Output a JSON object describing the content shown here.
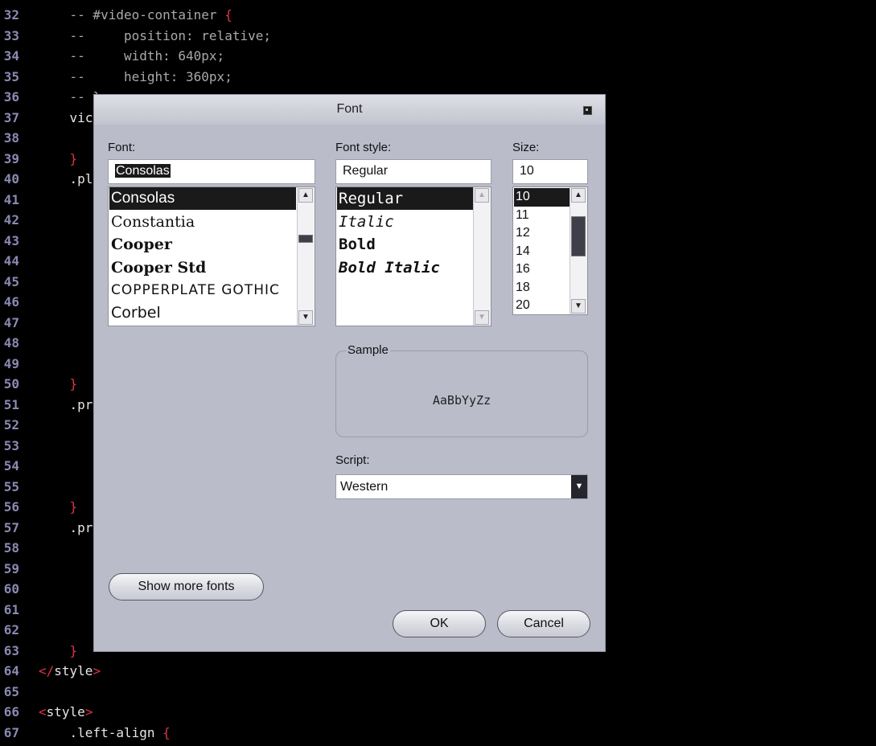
{
  "editor": {
    "lines": [
      {
        "n": "32",
        "tokens": [
          {
            "t": "    -- #video-container ",
            "c": "comment"
          },
          {
            "t": "{",
            "c": "brace"
          }
        ]
      },
      {
        "n": "33",
        "tokens": [
          {
            "t": "    --     position: relative;",
            "c": "comment"
          }
        ]
      },
      {
        "n": "34",
        "tokens": [
          {
            "t": "    --     width: 640px;",
            "c": "comment"
          }
        ]
      },
      {
        "n": "35",
        "tokens": [
          {
            "t": "    --     height: 360px;",
            "c": "comment"
          }
        ]
      },
      {
        "n": "36",
        "tokens": [
          {
            "t": "    -- }",
            "c": "comment"
          }
        ]
      },
      {
        "n": "37",
        "tokens": [
          {
            "t": "    vic",
            "c": "sel"
          }
        ]
      },
      {
        "n": "38",
        "tokens": []
      },
      {
        "n": "39",
        "tokens": [
          {
            "t": "    }",
            "c": "brace"
          }
        ]
      },
      {
        "n": "40",
        "tokens": [
          {
            "t": "    .pl",
            "c": "sel"
          }
        ]
      },
      {
        "n": "41",
        "tokens": []
      },
      {
        "n": "42",
        "tokens": []
      },
      {
        "n": "43",
        "tokens": []
      },
      {
        "n": "44",
        "tokens": []
      },
      {
        "n": "45",
        "tokens": []
      },
      {
        "n": "46",
        "tokens": []
      },
      {
        "n": "47",
        "tokens": []
      },
      {
        "n": "48",
        "tokens": []
      },
      {
        "n": "49",
        "tokens": []
      },
      {
        "n": "50",
        "tokens": [
          {
            "t": "    }",
            "c": "brace"
          }
        ]
      },
      {
        "n": "51",
        "tokens": [
          {
            "t": "    .pr",
            "c": "sel"
          }
        ]
      },
      {
        "n": "52",
        "tokens": []
      },
      {
        "n": "53",
        "tokens": []
      },
      {
        "n": "54",
        "tokens": []
      },
      {
        "n": "55",
        "tokens": []
      },
      {
        "n": "56",
        "tokens": [
          {
            "t": "    }",
            "c": "brace"
          }
        ]
      },
      {
        "n": "57",
        "tokens": [
          {
            "t": "    .pr",
            "c": "sel"
          }
        ]
      },
      {
        "n": "58",
        "tokens": []
      },
      {
        "n": "59",
        "tokens": []
      },
      {
        "n": "60",
        "tokens": []
      },
      {
        "n": "61",
        "tokens": []
      },
      {
        "n": "62",
        "tokens": []
      },
      {
        "n": "63",
        "tokens": [
          {
            "t": "    }",
            "c": "brace"
          }
        ]
      },
      {
        "n": "64",
        "tokens": [
          {
            "t": "</",
            "c": "angle"
          },
          {
            "t": "style",
            "c": "tag"
          },
          {
            "t": ">",
            "c": "angle"
          }
        ]
      },
      {
        "n": "65",
        "tokens": []
      },
      {
        "n": "66",
        "tokens": [
          {
            "t": "<",
            "c": "angle"
          },
          {
            "t": "style",
            "c": "tag"
          },
          {
            "t": ">",
            "c": "angle"
          }
        ]
      },
      {
        "n": "67",
        "tokens": [
          {
            "t": "    .left-align ",
            "c": "sel"
          },
          {
            "t": "{",
            "c": "brace"
          }
        ]
      }
    ]
  },
  "dialog": {
    "title": "Font",
    "font": {
      "label": "Font:",
      "value": "Consolas",
      "items": [
        "Consolas",
        "Constantia",
        "Cooper",
        "Cooper Std",
        "COPPERPLATE GOTHIC",
        "Corbel"
      ],
      "selected": "Consolas"
    },
    "style": {
      "label": "Font style:",
      "value": "Regular",
      "items": [
        "Regular",
        "Italic",
        "Bold",
        "Bold Italic"
      ],
      "selected": "Regular"
    },
    "size": {
      "label": "Size:",
      "value": "10",
      "items": [
        "10",
        "11",
        "12",
        "14",
        "16",
        "18",
        "20"
      ],
      "selected": "10"
    },
    "sample": {
      "label": "Sample",
      "text": "AaBbYyZz"
    },
    "script": {
      "label": "Script:",
      "value": "Western"
    },
    "buttons": {
      "more_fonts": "Show more fonts",
      "ok": "OK",
      "cancel": "Cancel"
    }
  }
}
